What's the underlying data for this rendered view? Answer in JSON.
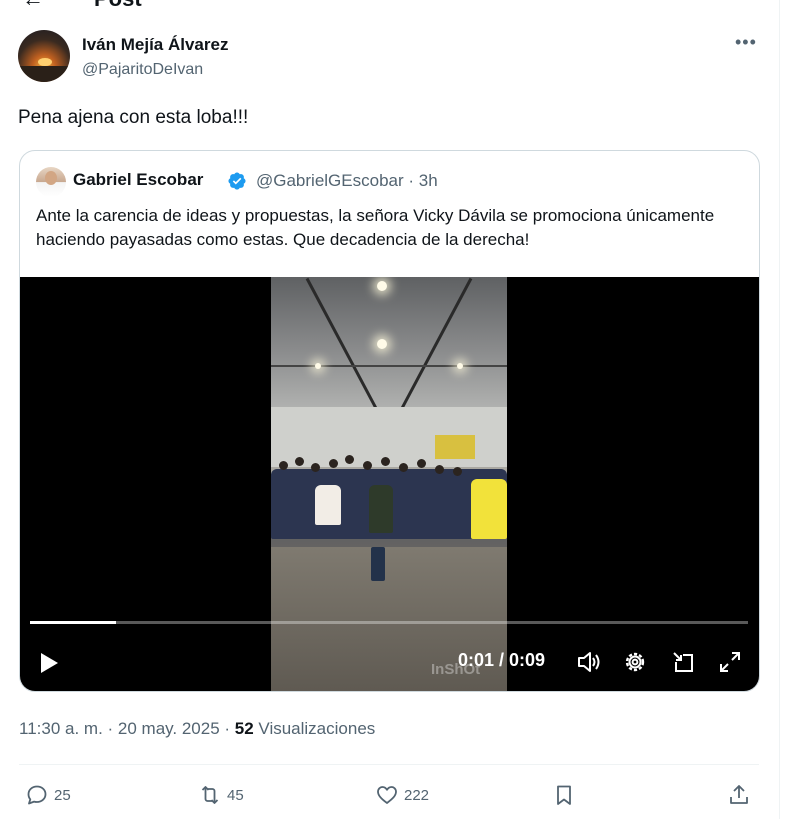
{
  "header": {
    "title": "Post"
  },
  "author": {
    "name": "Iván Mejía Álvarez",
    "handle": "@PajaritoDeIvan"
  },
  "post": {
    "text": "Pena ajena con esta loba!!!"
  },
  "quote": {
    "name": "Gabriel Escobar",
    "handle_time": "@GabrielGEscobar · 3h",
    "text": "Ante la carencia de ideas y propuestas, la señora Vicky Dávila se promociona únicamente haciendo payasadas como estas. Que decadencia de la derecha!",
    "video": {
      "time": "0:01 / 0:09",
      "progress": 0.12,
      "watermark": "InShOt"
    }
  },
  "meta": {
    "time_date": "11:30 a. m. · 20 may. 2025 · ",
    "views_count": "52",
    "views_label": " Visualizaciones"
  },
  "actions": {
    "replies": "25",
    "reposts": "45",
    "likes": "222"
  },
  "colors": {
    "text_primary": "#0f1419",
    "text_secondary": "#536471",
    "verified": "#1d9bf0",
    "border": "#cfd9de"
  }
}
